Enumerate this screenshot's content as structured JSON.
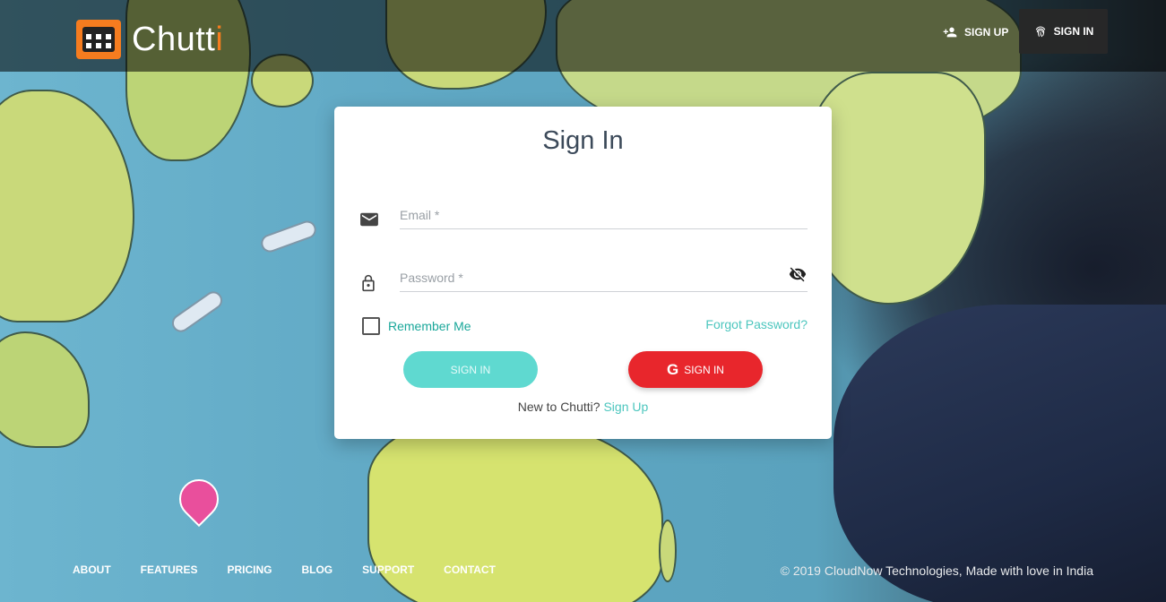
{
  "header": {
    "logo_text": "Chutt",
    "logo_text_accent": "i",
    "signup_label": "SIGN UP",
    "signin_label": "SIGN IN"
  },
  "card": {
    "title": "Sign In",
    "email_placeholder": "Email *",
    "password_placeholder": "Password *",
    "remember_label": "Remember Me",
    "forgot_label": "Forgot Password?",
    "signin_button": "SIGN IN",
    "google_button": "SIGN IN",
    "new_to_text": "New to Chutti?",
    "signup_link": "Sign Up"
  },
  "footer": {
    "nav": [
      "ABOUT",
      "FEATURES",
      "PRICING",
      "BLOG",
      "SUPPORT",
      "CONTACT"
    ],
    "copyright": "© 2019 CloudNow Technologies, Made with love in India"
  },
  "colors": {
    "accent_orange": "#f57c1f",
    "teal": "#5fd9d0",
    "google_red": "#e8262c",
    "link_teal": "#4cc6be"
  },
  "icons": [
    "person-add-icon",
    "fingerprint-icon",
    "email-icon",
    "lock-icon",
    "eye-off-icon",
    "google-icon",
    "calendar-logo-icon"
  ]
}
